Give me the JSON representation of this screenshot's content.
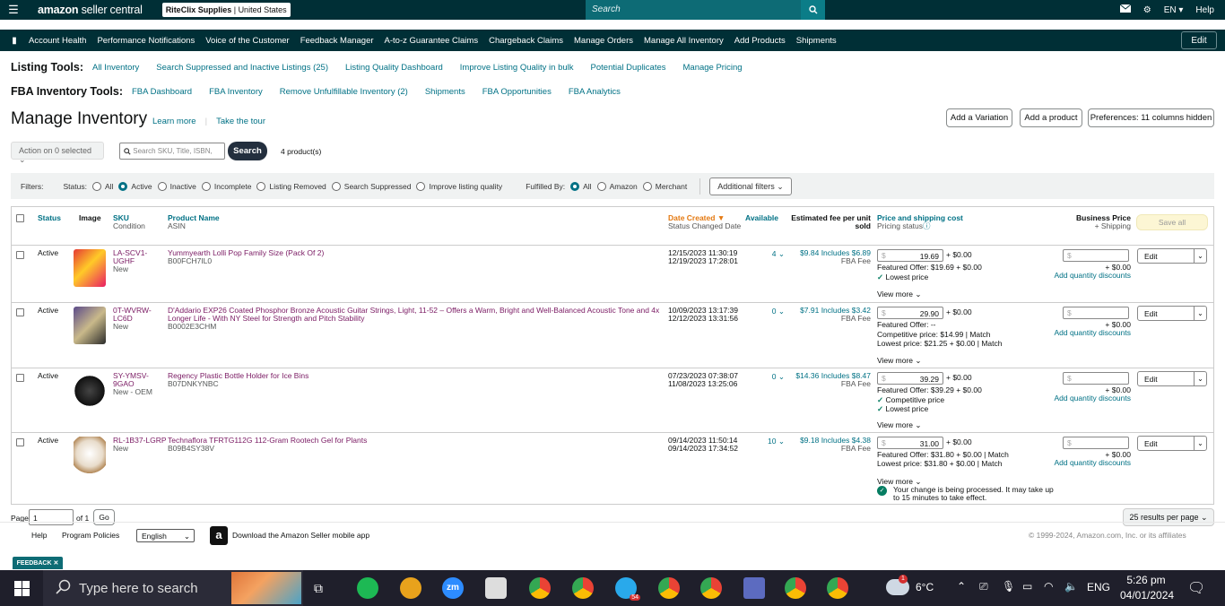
{
  "topbar": {
    "logo_a": "amazon",
    "logo_b": " seller central",
    "store_name": "RiteClix Supplies",
    "store_country": "United States",
    "search_placeholder": "Search",
    "language": "EN",
    "help": "Help"
  },
  "nav": {
    "items": [
      "Account Health",
      "Performance Notifications",
      "Voice of the Customer",
      "Feedback Manager",
      "A-to-z Guarantee Claims",
      "Chargeback Claims",
      "Manage Orders",
      "Manage All Inventory",
      "Add Products",
      "Shipments"
    ],
    "edit": "Edit"
  },
  "listing_tools": {
    "label": "Listing Tools:",
    "links": [
      "All Inventory",
      "Search Suppressed and Inactive Listings (25)",
      "Listing Quality Dashboard",
      "Improve Listing Quality in bulk",
      "Potential Duplicates",
      "Manage Pricing"
    ]
  },
  "fba_tools": {
    "label": "FBA Inventory Tools:",
    "links": [
      "FBA Dashboard",
      "FBA Inventory",
      "Remove Unfulfillable Inventory (2)",
      "Shipments",
      "FBA Opportunities",
      "FBA Analytics"
    ]
  },
  "page": {
    "title": "Manage Inventory",
    "learn_more": "Learn more",
    "tour": "Take the tour",
    "add_variation": "Add a Variation",
    "add_product": "Add a product",
    "preferences": "Preferences: 11 columns hidden"
  },
  "toolbar": {
    "action": "Action on 0 selected",
    "search_placeholder": "Search SKU, Title, ISBN,",
    "search_btn": "Search",
    "count": "4 product(s)"
  },
  "filters": {
    "label": "Filters:",
    "status_label": "Status:",
    "status_options": [
      "All",
      "Active",
      "Inactive",
      "Incomplete",
      "Listing Removed",
      "Search Suppressed",
      "Improve listing quality"
    ],
    "status_selected": "Active",
    "fulfilled_label": "Fulfilled By:",
    "fulfilled_options": [
      "All",
      "Amazon",
      "Merchant"
    ],
    "fulfilled_selected": "All",
    "additional": "Additional filters"
  },
  "columns": {
    "status": "Status",
    "image": "Image",
    "sku": "SKU",
    "sku_sub": "Condition",
    "name": "Product Name",
    "name_sub": "ASIN",
    "date": "Date Created",
    "date_sub": "Status Changed Date",
    "available": "Available",
    "fee": "Estimated fee per unit sold",
    "price": "Price and shipping cost",
    "price_sub": "Pricing status",
    "biz": "Business Price",
    "biz_sub": "+ Shipping",
    "save_all": "Save all"
  },
  "rows": [
    {
      "status": "Active",
      "sku": "LA-SCV1-UGHF",
      "condition": "New",
      "name": "Yummyearth Lolli Pop Family Size (Pack Of 2)",
      "asin": "B00FCH7IL0",
      "created": "12/15/2023 11:30:19",
      "changed": "12/19/2023 17:28:01",
      "available": "4",
      "fee": "$9.84 Includes $6.89",
      "fee2": "FBA Fee",
      "price": "19.69",
      "ship": "+ $0.00",
      "lines": [
        "Featured Offer: $19.69 + $0.00"
      ],
      "checks": [
        "Lowest price"
      ],
      "view_more": "View more",
      "biz_ship": "+ $0.00",
      "qty": "Add quantity discounts",
      "edit": "Edit"
    },
    {
      "status": "Active",
      "sku": "0T-WVRW-LC6D",
      "condition": "New",
      "name": "D'Addario EXP26 Coated Phosphor Bronze Acoustic Guitar Strings, Light, 11-52 – Offers a Warm, Bright and Well-Balanced Acoustic Tone and 4x Longer Life - With NY Steel for Strength and Pitch Stability",
      "asin": "B0002E3CHM",
      "created": "10/09/2023 13:17:39",
      "changed": "12/12/2023 13:31:56",
      "available": "0",
      "fee": "$7.91 Includes $3.42",
      "fee2": "FBA Fee",
      "price": "29.90",
      "ship": "+ $0.00",
      "lines": [
        "Featured Offer: --",
        "Competitive price: $14.99 | Match",
        "Lowest price: $21.25 + $0.00 | Match"
      ],
      "checks": [],
      "view_more": "View more",
      "biz_ship": "+ $0.00",
      "qty": "Add quantity discounts",
      "edit": "Edit"
    },
    {
      "status": "Active",
      "sku": "SY-YMSV-9GAO",
      "condition": "New - OEM",
      "name": "Regency Plastic Bottle Holder for Ice Bins",
      "asin": "B07DNKYNBC",
      "created": "07/23/2023 07:38:07",
      "changed": "11/08/2023 13:25:06",
      "available": "0",
      "fee": "$14.36 Includes $8.47",
      "fee2": "FBA Fee",
      "price": "39.29",
      "ship": "+ $0.00",
      "lines": [
        "Featured Offer: $39.29 + $0.00"
      ],
      "checks": [
        "Competitive price",
        "Lowest price"
      ],
      "view_more": "View more",
      "biz_ship": "+ $0.00",
      "qty": "Add quantity discounts",
      "edit": "Edit"
    },
    {
      "status": "Active",
      "sku": "RL-1B37-LGRP",
      "condition": "New",
      "name": "Technaflora TFRTG112G 112-Gram Rootech Gel for Plants",
      "asin": "B09B4SY38V",
      "created": "09/14/2023 11:50:14",
      "changed": "09/14/2023 17:34:52",
      "available": "10",
      "fee": "$9.18 Includes $4.38",
      "fee2": "FBA Fee",
      "price": "31.00",
      "ship": "+ $0.00",
      "lines": [
        "Featured Offer: $31.80 + $0.00 | Match",
        "Lowest price: $31.80 + $0.00 | Match"
      ],
      "checks": [],
      "view_more": "View more",
      "notice": "Your change is being processed. It may take up to 15 minutes to take effect.",
      "biz_ship": "+ $0.00",
      "qty": "Add quantity discounts",
      "edit": "Edit"
    }
  ],
  "pager": {
    "page_label": "Page",
    "page_value": "1",
    "of": "of 1",
    "go": "Go",
    "per_page": "25 results per page"
  },
  "footer": {
    "help": "Help",
    "policies": "Program Policies",
    "language": "English",
    "app": "Download the Amazon Seller mobile app",
    "copyright": "© 1999-2024, Amazon.com, Inc. or its affiliates",
    "feedback": "FEEDBACK"
  },
  "taskbar": {
    "search": "Type here to search",
    "temp": "6°C",
    "lang": "ENG",
    "time": "5:26 pm",
    "date": "04/01/2024",
    "telegram_badge": "54",
    "weather_badge": "1"
  }
}
